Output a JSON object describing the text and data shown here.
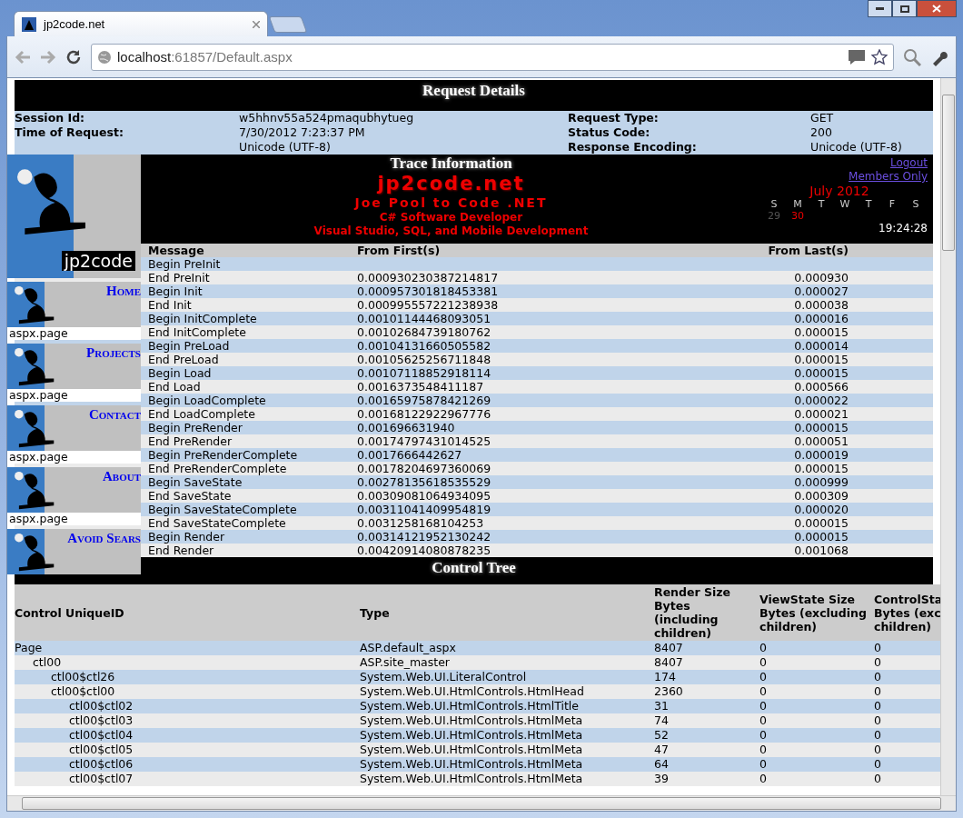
{
  "browser": {
    "tabs": [
      {
        "title": "jp2code.net",
        "selected": true
      }
    ],
    "address": {
      "host": "localhost",
      "rest": ":61857/Default.aspx"
    }
  },
  "request_details": {
    "title": "Request Details",
    "fields": [
      {
        "label": "Session Id:",
        "value": "w5hhnv55a524pmaqubhytueg",
        "label2": "Request Type:",
        "value2": "GET"
      },
      {
        "label": "Time of Request:",
        "value": "7/30/2012 7:23:37 PM",
        "label2": "Status Code:",
        "value2": "200"
      },
      {
        "value": "Unicode (UTF-8)",
        "label2": "Response Encoding:",
        "value2": "Unicode (UTF-8)"
      }
    ]
  },
  "site": {
    "logo_text": "jp2code",
    "name": "jp2code.net",
    "tagline": "Joe Pool to Code .NET",
    "role": "C# Software Developer",
    "skills": "Visual Studio, SQL, and Mobile Development",
    "nav": [
      {
        "label": "Home",
        "caption": "aspx.page"
      },
      {
        "label": "Projects",
        "caption": "aspx.page"
      },
      {
        "label": "Contact",
        "caption": "aspx.page"
      },
      {
        "label": "About",
        "caption": "aspx.page"
      },
      {
        "label": "Avoid Sears"
      }
    ],
    "links": [
      "Logout",
      "Members Only"
    ],
    "calendar": {
      "month": "July 2012",
      "days": [
        "S",
        "M",
        "T",
        "W",
        "T",
        "F",
        "S"
      ],
      "dates": [
        {
          "label": "29",
          "today": false
        },
        {
          "label": "30",
          "today": true
        }
      ]
    },
    "time": "19:24:28"
  },
  "trace": {
    "title": "Trace Information",
    "columns": [
      "Message",
      "From First(s)",
      "From Last(s)"
    ],
    "rows": [
      {
        "message": "Begin PreInit"
      },
      {
        "message": "End PreInit",
        "first": "0.000930230387214817",
        "last": "0.000930"
      },
      {
        "message": "Begin Init",
        "first": "0.000957301818453381",
        "last": "0.000027"
      },
      {
        "message": "End Init",
        "first": "0.000995557221238938",
        "last": "0.000038"
      },
      {
        "message": "Begin InitComplete",
        "first": "0.00101144468093051",
        "last": "0.000016"
      },
      {
        "message": "End InitComplete",
        "first": "0.00102684739180762",
        "last": "0.000015"
      },
      {
        "message": "Begin PreLoad",
        "first": "0.00104131660505582",
        "last": "0.000014"
      },
      {
        "message": "End PreLoad",
        "first": "0.00105625256711848",
        "last": "0.000015"
      },
      {
        "message": "Begin Load",
        "first": "0.00107118852918114",
        "last": "0.000015"
      },
      {
        "message": "End Load",
        "first": "0.0016373548411187",
        "last": "0.000566"
      },
      {
        "message": "Begin LoadComplete",
        "first": "0.00165975878421269",
        "last": "0.000022"
      },
      {
        "message": "End LoadComplete",
        "first": "0.00168122922967776",
        "last": "0.000021"
      },
      {
        "message": "Begin PreRender",
        "first": "0.001696631940",
        "last": "0.000015"
      },
      {
        "message": "End PreRender",
        "first": "0.00174797431014525",
        "last": "0.000051"
      },
      {
        "message": "Begin PreRenderComplete",
        "first": "0.0017666442627",
        "last": "0.000019"
      },
      {
        "message": "End PreRenderComplete",
        "first": "0.00178204697360069",
        "last": "0.000015"
      },
      {
        "message": "Begin SaveState",
        "first": "0.00278135618535529",
        "last": "0.000999"
      },
      {
        "message": "End SaveState",
        "first": "0.00309081064934095",
        "last": "0.000309"
      },
      {
        "message": "Begin SaveStateComplete",
        "first": "0.00311041409954819",
        "last": "0.000020"
      },
      {
        "message": "End SaveStateComplete",
        "first": "0.0031258168104253",
        "last": "0.000015"
      },
      {
        "message": "Begin Render",
        "first": "0.00314121952130242",
        "last": "0.000015"
      },
      {
        "message": "End Render",
        "first": "0.00420914080878235",
        "last": "0.001068"
      }
    ]
  },
  "control_tree": {
    "title": "Control Tree",
    "columns": [
      "Control UniqueID",
      "Type",
      "Render Size Bytes (including children)",
      "ViewState Size Bytes (excluding children)",
      "ControlSta Bytes (exc children)"
    ],
    "rows": [
      {
        "id": "Page",
        "type": "ASP.default_aspx",
        "render": "8407",
        "viewstate": "0",
        "controlstate": "0",
        "children": [
          {
            "id": "ctl00",
            "type": "ASP.site_master",
            "render": "8407",
            "viewstate": "0",
            "controlstate": "0",
            "children": [
              {
                "id": "ctl00$ctl26",
                "type": "System.Web.UI.LiteralControl",
                "render": "174",
                "viewstate": "0",
                "controlstate": "0"
              },
              {
                "id": "ctl00$ctl00",
                "type": "System.Web.UI.HtmlControls.HtmlHead",
                "render": "2360",
                "viewstate": "0",
                "controlstate": "0",
                "children": [
                  {
                    "id": "ctl00$ctl02",
                    "type": "System.Web.UI.HtmlControls.HtmlTitle",
                    "render": "31",
                    "viewstate": "0",
                    "controlstate": "0"
                  },
                  {
                    "id": "ctl00$ctl03",
                    "type": "System.Web.UI.HtmlControls.HtmlMeta",
                    "render": "74",
                    "viewstate": "0",
                    "controlstate": "0"
                  },
                  {
                    "id": "ctl00$ctl04",
                    "type": "System.Web.UI.HtmlControls.HtmlMeta",
                    "render": "52",
                    "viewstate": "0",
                    "controlstate": "0"
                  },
                  {
                    "id": "ctl00$ctl05",
                    "type": "System.Web.UI.HtmlControls.HtmlMeta",
                    "render": "47",
                    "viewstate": "0",
                    "controlstate": "0"
                  },
                  {
                    "id": "ctl00$ctl06",
                    "type": "System.Web.UI.HtmlControls.HtmlMeta",
                    "render": "64",
                    "viewstate": "0",
                    "controlstate": "0"
                  },
                  {
                    "id": "ctl00$ctl07",
                    "type": "System.Web.UI.HtmlControls.HtmlMeta",
                    "render": "39",
                    "viewstate": "0",
                    "controlstate": "0"
                  }
                ]
              }
            ]
          }
        ]
      }
    ]
  }
}
